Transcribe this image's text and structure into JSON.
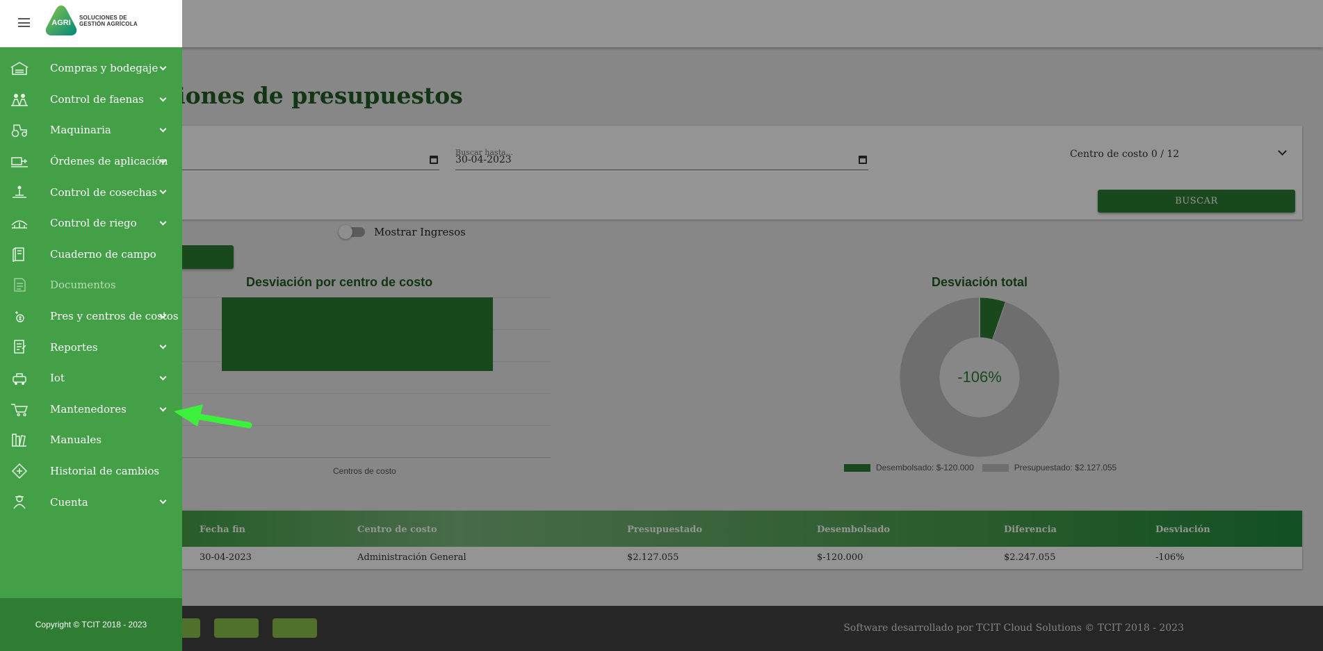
{
  "app": {
    "logo_text_line1": "SOLUCIONES DE",
    "logo_text_line2": "GESTIÓN AGRÍCOLA",
    "logo_mark_text": "AGRI"
  },
  "page": {
    "title": "ciones de presupuestos"
  },
  "filters": {
    "date_from_value": "",
    "date_to_label": "Buscar hasta...",
    "date_to_value": "30-04-2023",
    "cost_center_value": "Centro de costo 0 / 12",
    "search_button": "BUSCAR"
  },
  "toggle": {
    "label": "Mostrar Ingresos",
    "on": false
  },
  "charts": {
    "bar_title": "Desviación por centro de costo",
    "bar_xlabel": "Centros de costo",
    "donut_title": "Desviación total",
    "donut_center": "-106%"
  },
  "chart_data": [
    {
      "type": "bar",
      "title": "Desviación por centro de costo",
      "xlabel": "Centros de costo",
      "categories": [
        "Administración General"
      ],
      "values": [
        -106
      ],
      "color": "#2e7d32"
    },
    {
      "type": "pie",
      "title": "Desviación total",
      "center_label": "-106%",
      "slices": [
        {
          "name": "Desembolsado: $-120.000",
          "value": 120000,
          "color": "#2e7d32"
        },
        {
          "name": "Presupuestado: $2.127.055",
          "value": 2127055,
          "color": "#bdbdbd"
        }
      ],
      "legend_position": "bottom"
    }
  ],
  "legend": {
    "item1": "Desembolsado: $-120.000",
    "item2": "Presupuestado: $2.127.055"
  },
  "table": {
    "headers": [
      "Fecha fin",
      "Centro de costo",
      "Presupuestado",
      "Desembolsado",
      "Diferencia",
      "Desviación"
    ],
    "rows": [
      [
        "30-04-2023",
        "Administración General",
        "$2.127.055",
        "$-120.000",
        "$2.247.055",
        "-106%"
      ]
    ]
  },
  "footer": {
    "text": "Software desarrollado por TCIT Cloud Solutions © TCIT 2018 - 2023"
  },
  "drawer": {
    "items": [
      {
        "label": "Compras y bodegaje",
        "icon": "warehouse-icon",
        "expandable": true,
        "disabled": false
      },
      {
        "label": "Control de faenas",
        "icon": "workers-icon",
        "expandable": true,
        "disabled": false
      },
      {
        "label": "Maquinaria",
        "icon": "tractor-icon",
        "expandable": true,
        "disabled": false
      },
      {
        "label": "Órdenes de aplicación",
        "icon": "sprayer-icon",
        "expandable": true,
        "disabled": false
      },
      {
        "label": "Control de cosechas",
        "icon": "harvest-icon",
        "expandable": true,
        "disabled": false
      },
      {
        "label": "Control de riego",
        "icon": "irrigation-icon",
        "expandable": true,
        "disabled": false
      },
      {
        "label": "Cuaderno de campo",
        "icon": "notebook-icon",
        "expandable": false,
        "disabled": false
      },
      {
        "label": "Documentos",
        "icon": "documents-icon",
        "expandable": false,
        "disabled": true
      },
      {
        "label": "Pres y centros de costos",
        "icon": "budget-icon",
        "expandable": true,
        "disabled": false
      },
      {
        "label": "Reportes",
        "icon": "reports-icon",
        "expandable": true,
        "disabled": false
      },
      {
        "label": "Iot",
        "icon": "iot-icon",
        "expandable": true,
        "disabled": false
      },
      {
        "label": "Mantenedores",
        "icon": "maintainers-icon",
        "expandable": true,
        "disabled": false
      },
      {
        "label": "Manuales",
        "icon": "manuals-icon",
        "expandable": false,
        "disabled": false
      },
      {
        "label": "Historial de cambios",
        "icon": "history-icon",
        "expandable": false,
        "disabled": false
      },
      {
        "label": "Cuenta",
        "icon": "account-icon",
        "expandable": true,
        "disabled": false
      }
    ],
    "copyright": "Copyright © TCIT 2018 - 2023"
  },
  "annotation": {
    "arrow_color": "#3cf03c"
  }
}
